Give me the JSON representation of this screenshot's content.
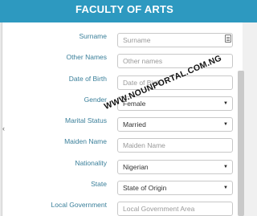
{
  "header": {
    "title": "FACULTY OF ARTS"
  },
  "form": {
    "surname": {
      "label": "Surname",
      "placeholder": "Surname",
      "icon": "contact-card-icon"
    },
    "other_names": {
      "label": "Other Names",
      "placeholder": "Other names"
    },
    "date_of_birth": {
      "label": "Date of Birth",
      "placeholder": "Date of Birth"
    },
    "gender": {
      "label": "Gender",
      "value": "Female"
    },
    "marital_status": {
      "label": "Marital Status",
      "value": "Married"
    },
    "maiden_name": {
      "label": "Maiden Name",
      "placeholder": "Maiden Name"
    },
    "nationality": {
      "label": "Nationality",
      "value": "Nigerian"
    },
    "state": {
      "label": "State",
      "value": "State of Origin"
    },
    "local_government": {
      "label": "Local Government",
      "placeholder": "Local Government Area"
    }
  },
  "watermark": {
    "text": "WWW.NOUNPORTAL.COM.NG"
  },
  "colors": {
    "header_bg": "#2d99c0",
    "label": "#3a7f9a"
  }
}
